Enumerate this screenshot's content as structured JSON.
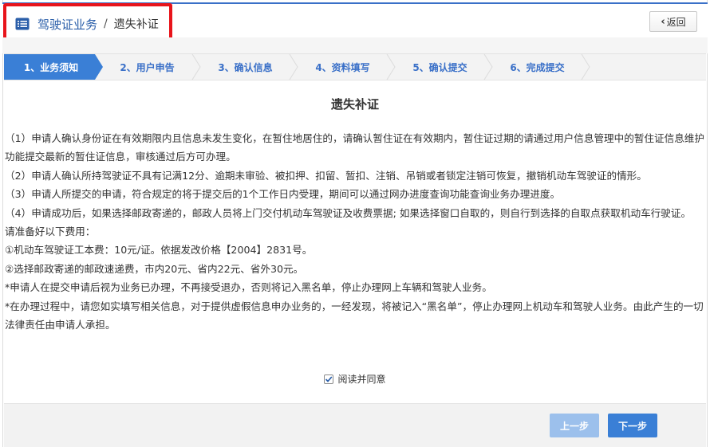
{
  "header": {
    "breadcrumb_main": "驾驶证业务",
    "breadcrumb_separator": "/",
    "breadcrumb_current": "遗失补证",
    "back_label": "返回",
    "icons": {
      "breadcrumb": "list-icon",
      "back": "chevron-left-icon"
    },
    "highlight_color": "#e8141b"
  },
  "steps": [
    {
      "label": "1、业务须知",
      "active": true
    },
    {
      "label": "2、用户申告",
      "active": false
    },
    {
      "label": "3、确认信息",
      "active": false
    },
    {
      "label": "4、资料填写",
      "active": false
    },
    {
      "label": "5、确认提交",
      "active": false
    },
    {
      "label": "6、完成提交",
      "active": false
    }
  ],
  "main": {
    "title": "遗失补证",
    "paragraphs": [
      "（1）申请人确认身份证在有效期限内且信息未发生变化，在暂住地居住的，请确认暂住证在有效期内，暂住证过期的请通过用户信息管理中的暂住证信息维护功能提交最新的暂住证信息，审核通过后方可办理。",
      "（2）申请人确认所持驾驶证不具有记满12分、逾期未审验、被扣押、扣留、暂扣、注销、吊销或者锁定注销可恢复，撤销机动车驾驶证的情形。",
      "（3）申请人所提交的申请，符合规定的将于提交后的1个工作日内受理，期间可以通过网办进度查询功能查询业务办理进度。",
      "（4）申请成功后，如果选择邮政寄递的，邮政人员将上门交付机动车驾驶证及收费票据; 如果选择窗口自取的，则自行到选择的自取点获取机动车行驶证。",
      "请准备好以下费用：",
      "①机动车驾驶证工本费：10元/证。依据发改价格【2004】2831号。",
      "②选择邮政寄递的邮政速递费，市内20元、省内22元、省外30元。",
      "*申请人在提交申请后视为业务已办理，不再接受退办，否则将记入黑名单，停止办理网上车辆和驾驶人业务。",
      "*在办理过程中，请您如实填写相关信息，对于提供虚假信息申办业务的，一经发现，将被记入“黑名单”，停止办理网上机动车和驾驶人业务。由此产生的一切法律责任由申请人承担。"
    ],
    "agree_label": "阅读并同意",
    "agree_checked": true
  },
  "footer": {
    "prev_label": "上一步",
    "next_label": "下一步"
  },
  "colors": {
    "accent": "#3a7fd6",
    "accent_disabled": "#9cc0ec",
    "link": "#2a5ea9"
  }
}
